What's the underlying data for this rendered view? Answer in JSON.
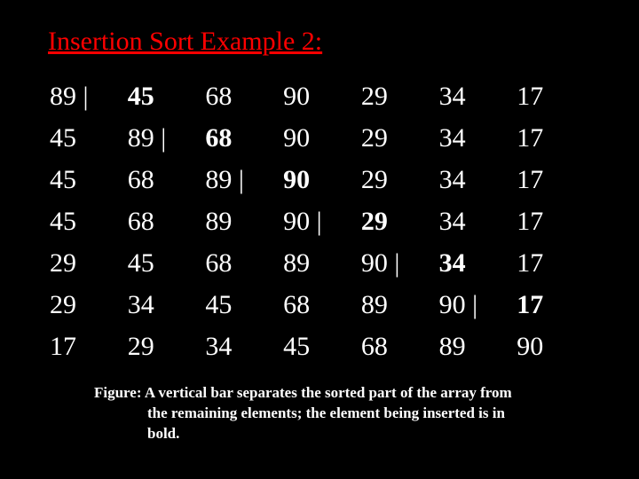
{
  "title": "Insertion Sort Example 2:",
  "rows": [
    [
      {
        "t": "89 |",
        "b": false
      },
      {
        "t": "45",
        "b": true
      },
      {
        "t": "68",
        "b": false
      },
      {
        "t": "90",
        "b": false
      },
      {
        "t": "29",
        "b": false
      },
      {
        "t": "34",
        "b": false
      },
      {
        "t": "17",
        "b": false
      }
    ],
    [
      {
        "t": "45",
        "b": false
      },
      {
        "t": "89 |",
        "b": false
      },
      {
        "t": "68",
        "b": true
      },
      {
        "t": "90",
        "b": false
      },
      {
        "t": "29",
        "b": false
      },
      {
        "t": "34",
        "b": false
      },
      {
        "t": "17",
        "b": false
      }
    ],
    [
      {
        "t": "45",
        "b": false
      },
      {
        "t": "68",
        "b": false
      },
      {
        "t": "89 |",
        "b": false
      },
      {
        "t": "90",
        "b": true
      },
      {
        "t": "29",
        "b": false
      },
      {
        "t": "34",
        "b": false
      },
      {
        "t": "17",
        "b": false
      }
    ],
    [
      {
        "t": "45",
        "b": false
      },
      {
        "t": "68",
        "b": false
      },
      {
        "t": "89",
        "b": false
      },
      {
        "t": "90 |",
        "b": false
      },
      {
        "t": "29",
        "b": true
      },
      {
        "t": "34",
        "b": false
      },
      {
        "t": "17",
        "b": false
      }
    ],
    [
      {
        "t": "29",
        "b": false
      },
      {
        "t": "45",
        "b": false
      },
      {
        "t": "68",
        "b": false
      },
      {
        "t": "89",
        "b": false
      },
      {
        "t": " 90 |",
        "b": false
      },
      {
        "t": "34",
        "b": true
      },
      {
        "t": "17",
        "b": false
      }
    ],
    [
      {
        "t": "29",
        "b": false
      },
      {
        "t": "34",
        "b": false
      },
      {
        "t": "45",
        "b": false
      },
      {
        "t": "68",
        "b": false
      },
      {
        "t": "89",
        "b": false
      },
      {
        "t": " 90 |",
        "b": false
      },
      {
        "t": "17",
        "b": true
      }
    ],
    [
      {
        "t": "17",
        "b": false
      },
      {
        "t": "29",
        "b": false
      },
      {
        "t": "34",
        "b": false
      },
      {
        "t": "45",
        "b": false
      },
      {
        "t": "68",
        "b": false
      },
      {
        "t": " 89",
        "b": false
      },
      {
        "t": " 90",
        "b": false
      }
    ]
  ],
  "caption_line1": "Figure: A vertical bar separates the sorted part of the array from",
  "caption_line2": "the remaining elements; the element being inserted is in",
  "caption_line3": "bold."
}
